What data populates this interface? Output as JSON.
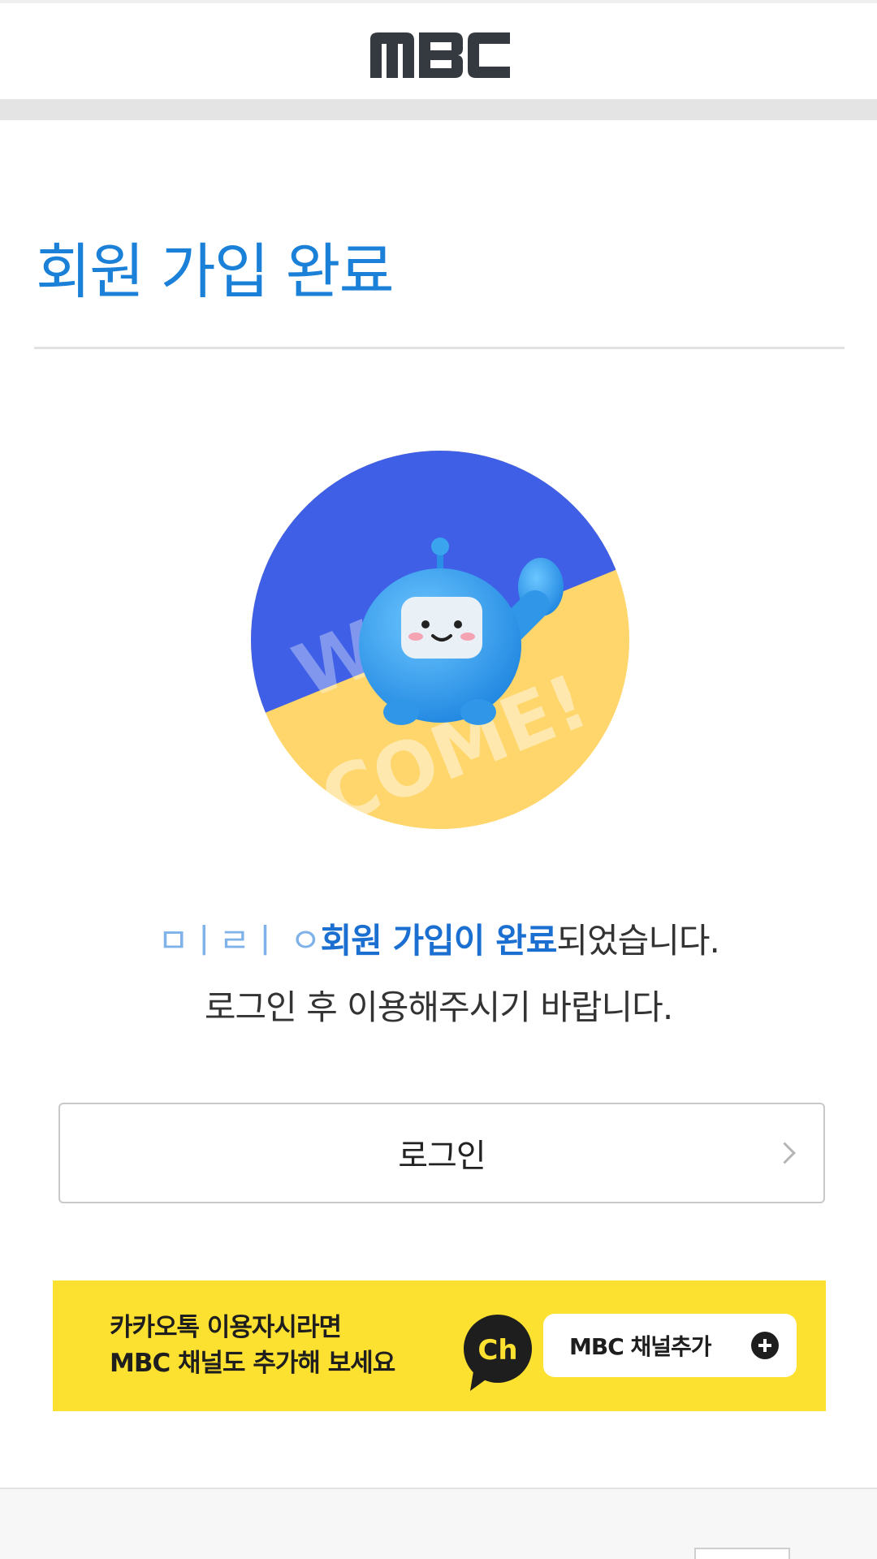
{
  "header": {
    "logo_text": "MBC"
  },
  "page": {
    "title": "회원 가입 완료"
  },
  "illustration": {
    "badge_text_top": "WEL-",
    "badge_text_bottom": "COME!",
    "colors": {
      "top": "#3e5fe6",
      "bottom": "#ffd66b",
      "character": "#3aa4ee"
    }
  },
  "message": {
    "user_name": "ㅁㅣㄹㅣ ㅇ",
    "highlight": "회원 가입이 완료",
    "line1_suffix": "되었습니다.",
    "line2": "로그인 후 이용해주시기 바랍니다."
  },
  "login": {
    "label": "로그인",
    "icon": "chevron-right-icon"
  },
  "kakao": {
    "line1": "카카오톡 이용자시라면",
    "line2": "MBC 채널도 추가해 보세요",
    "channel_icon_text": "Ch",
    "button_label": "MBC 채널추가",
    "button_icon": "plus-circle-icon",
    "bg_color": "#fde131"
  },
  "colors": {
    "accent": "#1a80d8",
    "divider": "#e2e2e2"
  }
}
